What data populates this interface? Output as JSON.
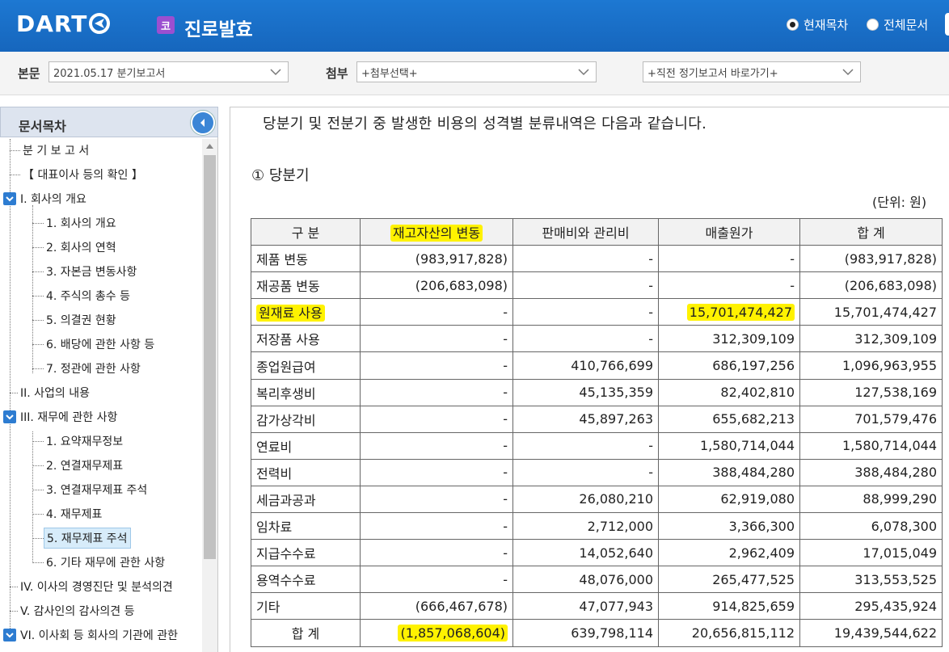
{
  "header": {
    "logo_text": "DART",
    "company_badge": "코",
    "company_name": "진로발효",
    "scope_current": "현재목차",
    "scope_all": "전체문서"
  },
  "toolbar": {
    "main_label": "본문",
    "main_select": "2021.05.17  분기보고서",
    "attach_label": "첨부",
    "attach_select": "+첨부선택+",
    "direct_select": "+직전 정기보고서 바로가기+"
  },
  "sidebar": {
    "title": "문서목차",
    "items": [
      "분 기 보 고 서",
      "【 대표이사 등의 확인 】",
      "I. 회사의 개요",
      "1. 회사의 개요",
      "2. 회사의 연혁",
      "3. 자본금 변동사항",
      "4. 주식의 총수 등",
      "5. 의결권 현황",
      "6. 배당에 관한 사항 등",
      "7. 정관에 관한 사항",
      "II. 사업의 내용",
      "III. 재무에 관한 사항",
      "1. 요약재무정보",
      "2. 연결재무제표",
      "3. 연결재무제표 주석",
      "4. 재무제표",
      "5. 재무제표 주석",
      "6. 기타 재무에 관한 사항",
      "IV. 이사의 경영진단 및 분석의견",
      "V. 감사인의 감사의견 등",
      "VI. 이사회 등 회사의 기관에 관한"
    ]
  },
  "content": {
    "intro": "당분기 및 전분기 중 발생한 비용의 성격별 분류내역은 다음과 같습니다.",
    "subhead": "① 당분기",
    "unit": "(단위: 원)",
    "table": {
      "headers": [
        "구    분",
        "재고자산의 변동",
        "판매비와 관리비",
        "매출원가",
        "합    계"
      ],
      "rows": [
        [
          "제품 변동",
          "(983,917,828)",
          "-",
          "-",
          "(983,917,828)"
        ],
        [
          "재공품 변동",
          "(206,683,098)",
          "-",
          "-",
          "(206,683,098)"
        ],
        [
          "원재료 사용",
          "-",
          "-",
          "15,701,474,427",
          "15,701,474,427"
        ],
        [
          "저장품 사용",
          "-",
          "-",
          "312,309,109",
          "312,309,109"
        ],
        [
          "종업원급여",
          "-",
          "410,766,699",
          "686,197,256",
          "1,096,963,955"
        ],
        [
          "복리후생비",
          "-",
          "45,135,359",
          "82,402,810",
          "127,538,169"
        ],
        [
          "감가상각비",
          "-",
          "45,897,263",
          "655,682,213",
          "701,579,476"
        ],
        [
          "연료비",
          "-",
          "-",
          "1,580,714,044",
          "1,580,714,044"
        ],
        [
          "전력비",
          "-",
          "-",
          "388,484,280",
          "388,484,280"
        ],
        [
          "세금과공과",
          "-",
          "26,080,210",
          "62,919,080",
          "88,999,290"
        ],
        [
          "임차료",
          "-",
          "2,712,000",
          "3,366,300",
          "6,078,300"
        ],
        [
          "지급수수료",
          "-",
          "14,052,640",
          "2,962,409",
          "17,015,049"
        ],
        [
          "용역수수료",
          "-",
          "48,076,000",
          "265,477,525",
          "313,553,525"
        ],
        [
          "기타",
          "(666,467,678)",
          "47,077,943",
          "914,825,659",
          "295,435,924"
        ],
        [
          "합    계",
          "(1,857,068,604)",
          "639,798,114",
          "20,656,815,112",
          "19,439,544,622"
        ]
      ]
    },
    "highlight_color": "#fff200"
  }
}
